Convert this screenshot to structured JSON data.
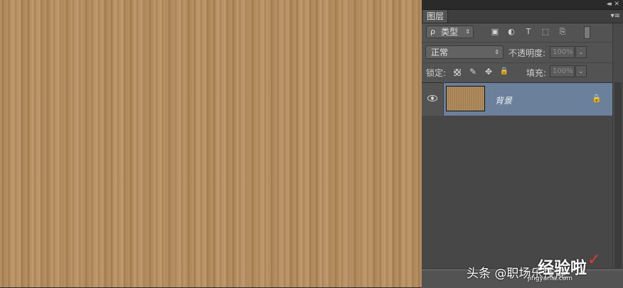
{
  "panel": {
    "tab_label": "图层",
    "collapse_glyph": "◂◂",
    "close_glyph": "✕",
    "menu_glyph": "▾≡"
  },
  "filter": {
    "icon_glyph": "ρ",
    "kind_label": "类型",
    "arrow_glyph": "⇕",
    "buttons": [
      {
        "name": "filter-pixel-icon",
        "glyph": "▣"
      },
      {
        "name": "filter-adjustment-icon",
        "glyph": "◐"
      },
      {
        "name": "filter-type-icon",
        "glyph": "T"
      },
      {
        "name": "filter-shape-icon",
        "glyph": "⬚"
      },
      {
        "name": "filter-smartobject-icon",
        "glyph": "⎘"
      }
    ]
  },
  "blend": {
    "mode": "正常",
    "arrow_glyph": "⇕",
    "opacity_label": "不透明度:",
    "opacity_value": "100%",
    "dropdown_glyph": "⌄"
  },
  "lock": {
    "label": "锁定:",
    "buttons": [
      {
        "name": "lock-paint-icon",
        "glyph": "✎"
      },
      {
        "name": "lock-position-icon",
        "glyph": "✥"
      },
      {
        "name": "lock-all-icon",
        "glyph": "🔒"
      }
    ],
    "fill_label": "填充:",
    "fill_value": "100%",
    "dropdown_glyph": "⌄"
  },
  "layers": [
    {
      "name": "背景",
      "locked": true,
      "visible": true,
      "lock_glyph": "🔒"
    }
  ],
  "watermark": {
    "text": "头条 @职场乐技能",
    "logo": "经验啦",
    "check": "✓",
    "url": "jingyanla.com"
  }
}
